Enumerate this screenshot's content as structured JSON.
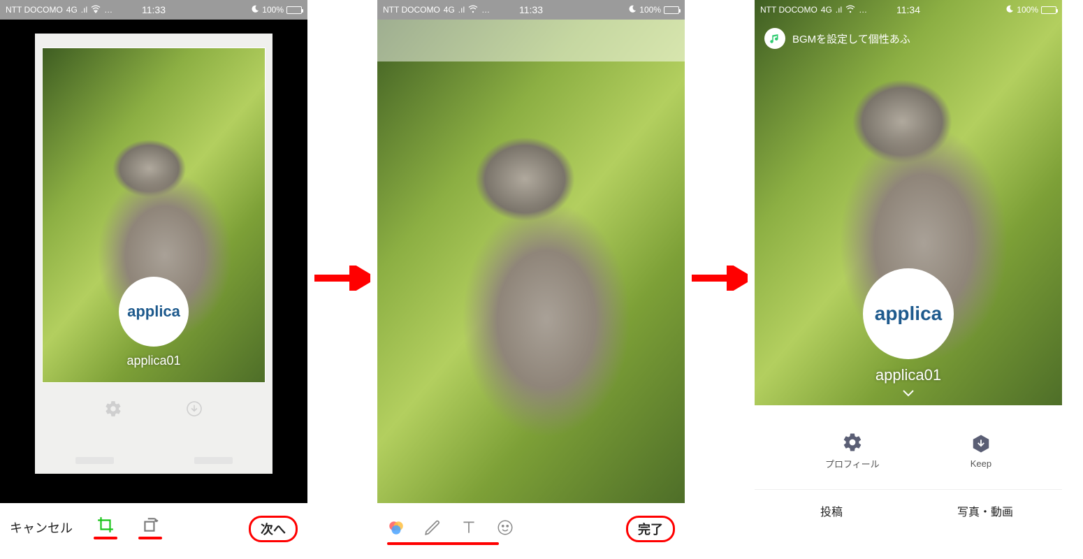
{
  "status": {
    "carrier": "NTT DOCOMO",
    "network": "4G",
    "dots": "…",
    "battery_pct": "100%",
    "time_a": "11:33",
    "time_b": "11:34"
  },
  "screen1": {
    "avatar_text": "applica",
    "username": "applica01",
    "cancel": "キャンセル",
    "next": "次へ"
  },
  "screen2": {
    "done": "完了"
  },
  "screen3": {
    "bgm_text": "BGMを設定して個性あふ",
    "avatar_text": "applica",
    "username": "applica01",
    "action_profile": "プロフィール",
    "action_keep": "Keep",
    "tab_posts": "投稿",
    "tab_media": "写真・動画"
  }
}
